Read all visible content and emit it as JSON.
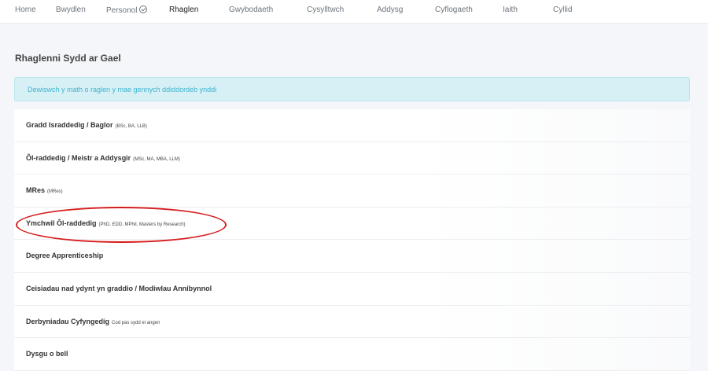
{
  "nav": {
    "items": [
      {
        "label": "Home"
      },
      {
        "label": "Bwydlen"
      },
      {
        "label": "Personol"
      },
      {
        "label": "Rhaglen"
      },
      {
        "label": "Gwybodaeth"
      },
      {
        "label": "Cysylltwch"
      },
      {
        "label": "Addysg"
      },
      {
        "label": "Cyflogaeth"
      },
      {
        "label": "Iaith"
      },
      {
        "label": "Cyllid"
      }
    ],
    "active": "Rhaglen",
    "personol_icon": "check-circle-icon"
  },
  "page": {
    "title": "Rhaglenni Sydd ar Gael"
  },
  "alert": {
    "text": "Dewiswch y math o raglen y mae gennych ddiddordeb ynddi"
  },
  "programs": [
    {
      "label": "Gradd Israddedig / Baglor",
      "sub": "(BSc, BA, LLB)"
    },
    {
      "label": "Ôl-raddedig / Meistr a Addysgir",
      "sub": "(MSc, MA, MBA, LLM)"
    },
    {
      "label": "MRes",
      "sub": "(MRes)"
    },
    {
      "label": "Ymchwil Ôl-raddedig",
      "sub": "(PhD, EDD, MPhil, Masters by Research)"
    },
    {
      "label": "Degree Apprenticeship",
      "sub": ""
    },
    {
      "label": "Ceisiadau nad ydynt yn graddio / Modiwlau Annibynnol",
      "sub": ""
    },
    {
      "label": "Derbyniadau Cyfyngedig",
      "sub": "Cod pas sydd ei angen"
    },
    {
      "label": "Dysgu o bell",
      "sub": ""
    }
  ],
  "annotation": {
    "color": "#d61d1d",
    "target": "Ymchwil Ôl-raddedig"
  }
}
